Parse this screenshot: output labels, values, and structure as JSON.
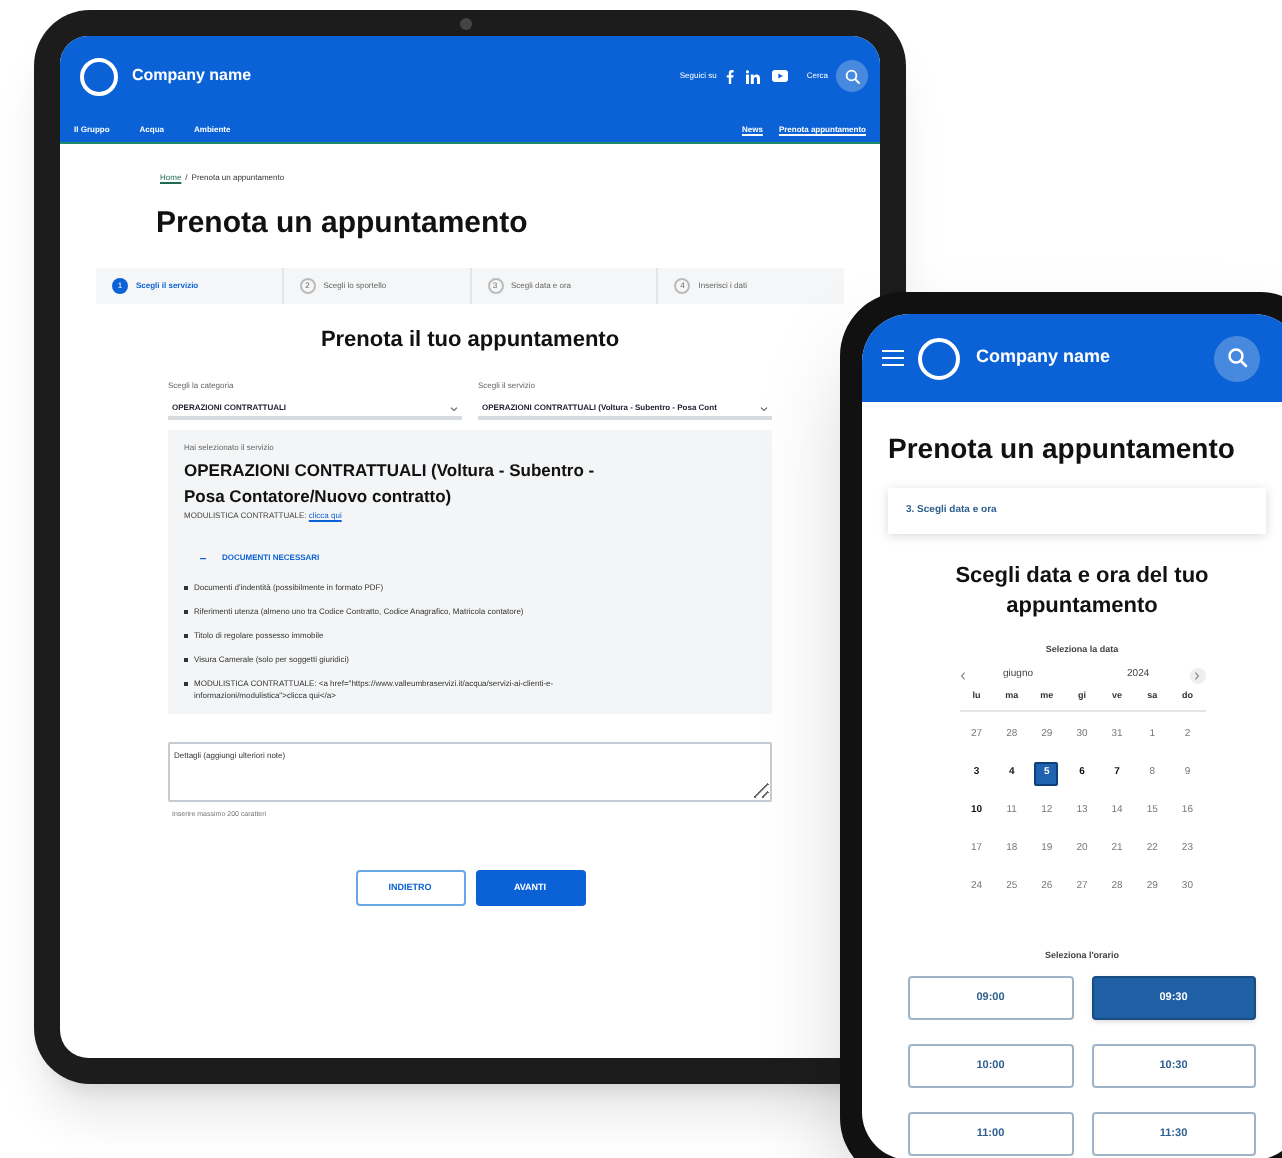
{
  "tablet": {
    "header": {
      "logo_text": "Company name",
      "follow_label": "Seguici su",
      "search_label": "Cerca",
      "nav_left": [
        "Il Gruppo",
        "Acqua",
        "Ambiente"
      ],
      "nav_right": [
        "News",
        "Prenota appuntamento"
      ]
    },
    "breadcrumb": {
      "home": "Home",
      "separator": "/",
      "current": "Prenota un appuntamento"
    },
    "page_title": "Prenota un appuntamento",
    "steps": [
      {
        "number": "1",
        "label": "Scegli il servizio",
        "selected": true
      },
      {
        "number": "2",
        "label": "Scegli lo sportello",
        "selected": false
      },
      {
        "number": "3",
        "label": "Scegli data e ora",
        "selected": false
      },
      {
        "number": "4",
        "label": "Inserisci i dati",
        "selected": false
      }
    ],
    "form_title": "Prenota il tuo appuntamento",
    "category": {
      "label": "Scegli la categoria",
      "value": "OPERAZIONI CONTRATTUALI"
    },
    "service": {
      "label": "Scegli il servizio",
      "value": "OPERAZIONI CONTRATTUALI (Voltura - Subentro - Posa Cont"
    },
    "selection": {
      "intro": "Hai selezionato il servizio",
      "title": "OPERAZIONI CONTRATTUALI (Voltura - Subentro - Posa Contatore/Nuovo contratto)",
      "forms_label": "MODULISTICA CONTRATTUALE:",
      "forms_link": "clicca qui",
      "documents_title": "DOCUMENTI NECESSARI",
      "documents_expanded": true,
      "documents": [
        "Documenti d'indentità (possibilmente in formato PDF)",
        "Riferimenti utenza (almeno uno tra Codice Contratto, Codice Anagrafico, Matricola contatore)",
        "Titolo di regolare possesso immobile",
        "Visura Camerale (solo per soggetti giuridici)",
        "MODULISTICA CONTRATTUALE: <a href=\"https://www.valleumbraservizi.it/acqua/servizi-ai-clienti-e-informazioni/modulistica\">clicca qui</a>"
      ]
    },
    "notes": {
      "placeholder": "Dettagli (aggiungi ulteriori note)",
      "hint": "Inserire massimo 200 caratteri"
    },
    "buttons": [
      {
        "label": "INDIETRO",
        "kind": "secondary"
      },
      {
        "label": "AVANTI",
        "kind": "primary"
      }
    ]
  },
  "phone": {
    "header": {
      "logo_text": "Company name"
    },
    "page_title": "Prenota un appuntamento",
    "current_step": "3. Scegli data e ora",
    "heading": "Scegli data e ora del tuo appuntamento",
    "date_label": "Seleziona la data",
    "calendar": {
      "month": "giugno",
      "year": "2024",
      "weekdays": [
        "lu",
        "ma",
        "me",
        "gi",
        "ve",
        "sa",
        "do"
      ],
      "days": [
        {
          "label": "27",
          "available": false,
          "selected": false
        },
        {
          "label": "28",
          "available": false,
          "selected": false
        },
        {
          "label": "29",
          "available": false,
          "selected": false
        },
        {
          "label": "30",
          "available": false,
          "selected": false
        },
        {
          "label": "31",
          "available": false,
          "selected": false
        },
        {
          "label": "1",
          "available": false,
          "selected": false
        },
        {
          "label": "2",
          "available": false,
          "selected": false
        },
        {
          "label": "3",
          "available": true,
          "selected": false
        },
        {
          "label": "4",
          "available": true,
          "selected": false
        },
        {
          "label": "5",
          "available": true,
          "selected": true
        },
        {
          "label": "6",
          "available": true,
          "selected": false
        },
        {
          "label": "7",
          "available": true,
          "selected": false
        },
        {
          "label": "8",
          "available": false,
          "selected": false
        },
        {
          "label": "9",
          "available": false,
          "selected": false
        },
        {
          "label": "10",
          "available": true,
          "selected": false
        },
        {
          "label": "11",
          "available": false,
          "selected": false
        },
        {
          "label": "12",
          "available": false,
          "selected": false
        },
        {
          "label": "13",
          "available": false,
          "selected": false
        },
        {
          "label": "14",
          "available": false,
          "selected": false
        },
        {
          "label": "15",
          "available": false,
          "selected": false
        },
        {
          "label": "16",
          "available": false,
          "selected": false
        },
        {
          "label": "17",
          "available": false,
          "selected": false
        },
        {
          "label": "18",
          "available": false,
          "selected": false
        },
        {
          "label": "19",
          "available": false,
          "selected": false
        },
        {
          "label": "20",
          "available": false,
          "selected": false
        },
        {
          "label": "21",
          "available": false,
          "selected": false
        },
        {
          "label": "22",
          "available": false,
          "selected": false
        },
        {
          "label": "23",
          "available": false,
          "selected": false
        },
        {
          "label": "24",
          "available": false,
          "selected": false
        },
        {
          "label": "25",
          "available": false,
          "selected": false
        },
        {
          "label": "26",
          "available": false,
          "selected": false
        },
        {
          "label": "27",
          "available": false,
          "selected": false
        },
        {
          "label": "28",
          "available": false,
          "selected": false
        },
        {
          "label": "29",
          "available": false,
          "selected": false
        },
        {
          "label": "30",
          "available": false,
          "selected": false
        }
      ]
    },
    "time_label": "Seleziona l'orario",
    "slots": [
      {
        "label": "09:00",
        "selected": false
      },
      {
        "label": "09:30",
        "selected": true
      },
      {
        "label": "10:00",
        "selected": false
      },
      {
        "label": "10:30",
        "selected": false
      },
      {
        "label": "11:00",
        "selected": false
      },
      {
        "label": "11:30",
        "selected": false
      }
    ]
  }
}
